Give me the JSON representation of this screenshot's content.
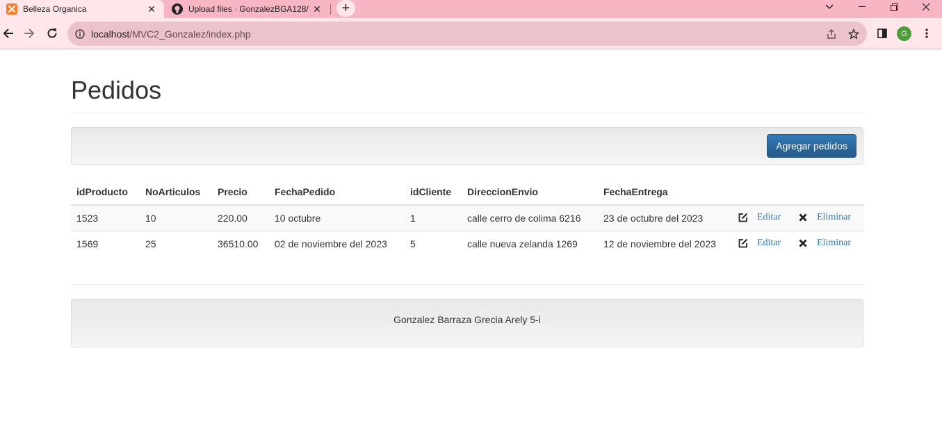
{
  "browser": {
    "tabs": [
      {
        "title": "Belleza Organica",
        "icon": "xampp-icon",
        "active": true
      },
      {
        "title": "Upload files · GonzalezBGA128/",
        "icon": "github-icon",
        "active": false
      }
    ],
    "url_host": "localhost",
    "url_path": "/MVC2_Gonzalez/index.php",
    "profile_initial": "G",
    "tab_color": "#f8b6c4",
    "toolbar_color": "#ffe6ea"
  },
  "page": {
    "title": "Pedidos",
    "add_button": "Agregar pedidos",
    "table": {
      "headers": [
        "idProducto",
        "NoArticulos",
        "Precio",
        "FechaPedido",
        "idCliente",
        "DireccionEnvio",
        "FechaEntrega"
      ],
      "rows": [
        {
          "idProducto": "1523",
          "NoArticulos": "10",
          "Precio": "220.00",
          "FechaPedido": "10 octubre",
          "idCliente": "1",
          "DireccionEnvio": "calle cerro de colima 6216",
          "FechaEntrega": "23 de octubre del 2023"
        },
        {
          "idProducto": "1569",
          "NoArticulos": "25",
          "Precio": "36510.00",
          "FechaPedido": "02 de noviembre del 2023",
          "idCliente": "5",
          "DireccionEnvio": "calle nueva zelanda 1269",
          "FechaEntrega": "12 de noviembre del 2023"
        }
      ],
      "edit_label": "Editar",
      "delete_label": "Eliminar"
    },
    "footer": "Gonzalez Barraza Grecia Arely 5-i"
  }
}
